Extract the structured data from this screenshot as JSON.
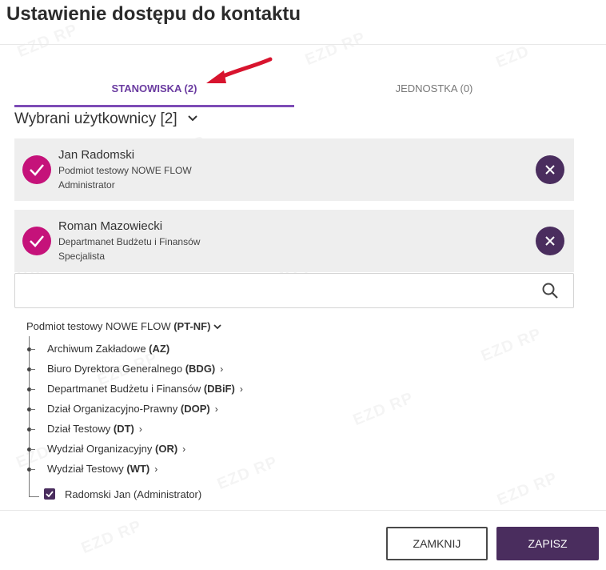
{
  "dialog": {
    "title": "Ustawienie dostępu do kontaktu"
  },
  "tabs": [
    {
      "label": "STANOWISKA (2)"
    },
    {
      "label": "JEDNOSTKA (0)"
    }
  ],
  "selected_header": "Wybrani użytkownicy [2]",
  "selected_users": [
    {
      "name": "Jan Radomski",
      "org": "Podmiot testowy NOWE FLOW",
      "role": "Administrator"
    },
    {
      "name": "Roman Mazowiecki",
      "org": "Departmanet Budżetu i Finansów",
      "role": "Specjalista"
    }
  ],
  "search": {
    "value": "",
    "placeholder": ""
  },
  "tree": {
    "root": {
      "name": "Podmiot testowy NOWE FLOW",
      "code": "(PT-NF)"
    },
    "items": [
      {
        "name": "Archiwum Zakładowe",
        "code": "(AZ)",
        "expandable": false
      },
      {
        "name": "Biuro Dyrektora Generalnego",
        "code": "(BDG)",
        "expandable": true
      },
      {
        "name": "Departmanet Budżetu i Finansów",
        "code": "(DBiF)",
        "expandable": true
      },
      {
        "name": "Dział Organizacyjno-Prawny",
        "code": "(DOP)",
        "expandable": true
      },
      {
        "name": "Dział Testowy",
        "code": "(DT)",
        "expandable": true
      },
      {
        "name": "Wydział Organizacyjny",
        "code": "(OR)",
        "expandable": true
      },
      {
        "name": "Wydział Testowy",
        "code": "(WT)",
        "expandable": true
      }
    ],
    "leaf": {
      "label": "Radomski Jan (Administrator)",
      "checked": true
    }
  },
  "buttons": {
    "close": "ZAMKNIJ",
    "save": "ZAPISZ"
  },
  "colors": {
    "accent": "#7d4cb6",
    "primary_dark": "#4a2d5e",
    "check_magenta": "#c5127a",
    "arrow_red": "#d8142e"
  }
}
